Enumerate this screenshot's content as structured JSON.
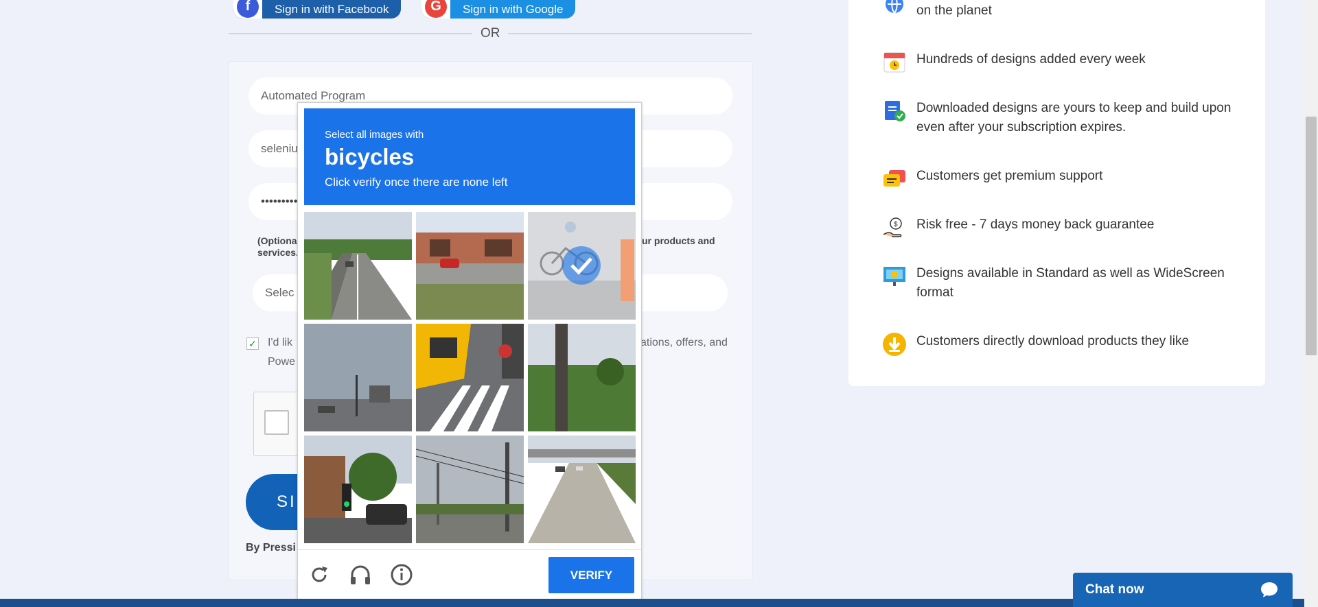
{
  "social": {
    "facebook_label": "Sign in with Facebook",
    "google_label": "Sign in with Google",
    "or_text": "OR"
  },
  "form": {
    "name_value": "Automated Program",
    "email_value": "seleniu",
    "password_value": "••••••••••",
    "optional_note_left": "(Optiona",
    "optional_note_left2": "services.",
    "optional_note_right": "ur products and",
    "select_placeholder": "Selec",
    "optin_left1": "I'd lik",
    "optin_left2": "Powe",
    "optin_right": "ations, offers, and",
    "signup_label": "SI",
    "by_pressing": "By Pressi"
  },
  "features": {
    "items": [
      {
        "icon": "globe-icon",
        "text": "on the planet"
      },
      {
        "icon": "calendar-icon",
        "text": "Hundreds of designs added every week"
      },
      {
        "icon": "clipboard-check-icon",
        "text": "Downloaded designs are yours to keep and build upon even after your subscription expires."
      },
      {
        "icon": "chat-bubbles-icon",
        "text": "Customers get premium support"
      },
      {
        "icon": "money-hand-icon",
        "text": "Risk free - 7 days money back guarantee"
      },
      {
        "icon": "presentation-screen-icon",
        "text": "Designs available in Standard as well as WideScreen format"
      },
      {
        "icon": "download-arrow-icon",
        "text": "Customers directly download products they like"
      }
    ]
  },
  "captcha": {
    "instruction": "Select all images with",
    "target": "bicycles",
    "subtext": "Click verify once there are none left",
    "verify_label": "VERIFY",
    "tiles": [
      {
        "scene": "road",
        "selected": false
      },
      {
        "scene": "restaurant-car",
        "selected": false
      },
      {
        "scene": "cyclist",
        "selected": true
      },
      {
        "scene": "street-sky",
        "selected": false
      },
      {
        "scene": "taxi-crosswalk",
        "selected": false
      },
      {
        "scene": "grass-pole",
        "selected": false
      },
      {
        "scene": "traffic-light",
        "selected": false
      },
      {
        "scene": "power-lines",
        "selected": false
      },
      {
        "scene": "highway",
        "selected": false
      }
    ],
    "colors": {
      "accent": "#1a73e8"
    }
  },
  "chat": {
    "label": "Chat now"
  }
}
